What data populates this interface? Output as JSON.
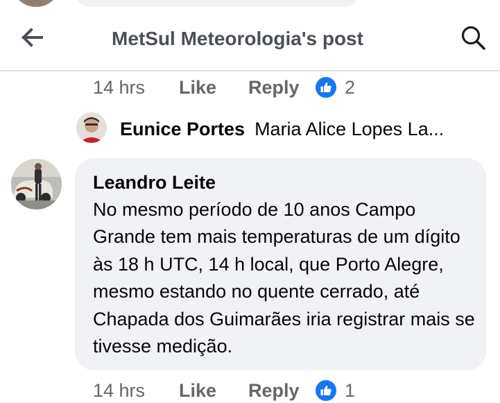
{
  "header": {
    "title": "MetSul Meteorologia's post",
    "back_icon": "arrow-left-icon",
    "search_icon": "search-icon"
  },
  "top_actions": {
    "time": "14 hrs",
    "like_label": "Like",
    "reply_label": "Reply",
    "reaction_icon": "thumbs-up-icon",
    "reaction_count": "2"
  },
  "reply_preview": {
    "author": "Eunice Portes",
    "text": "Maria Alice Lopes La..."
  },
  "comment": {
    "author": "Leandro Leite",
    "body": "No mesmo período de 10 anos Campo Grande tem mais temperaturas de um dígito às 18 h UTC, 14 h local, que Porto Alegre, mesmo estando no quente cerrado, até Chapada dos Guimarães iria registrar mais se tivesse medição."
  },
  "comment_actions": {
    "time": "14 hrs",
    "like_label": "Like",
    "reply_label": "Reply",
    "reaction_icon": "thumbs-up-icon",
    "reaction_count": "1"
  },
  "colors": {
    "accent": "#1877f2",
    "bubble": "#f0f2f5",
    "secondary_text": "#65676b",
    "divider": "#dadde1"
  }
}
